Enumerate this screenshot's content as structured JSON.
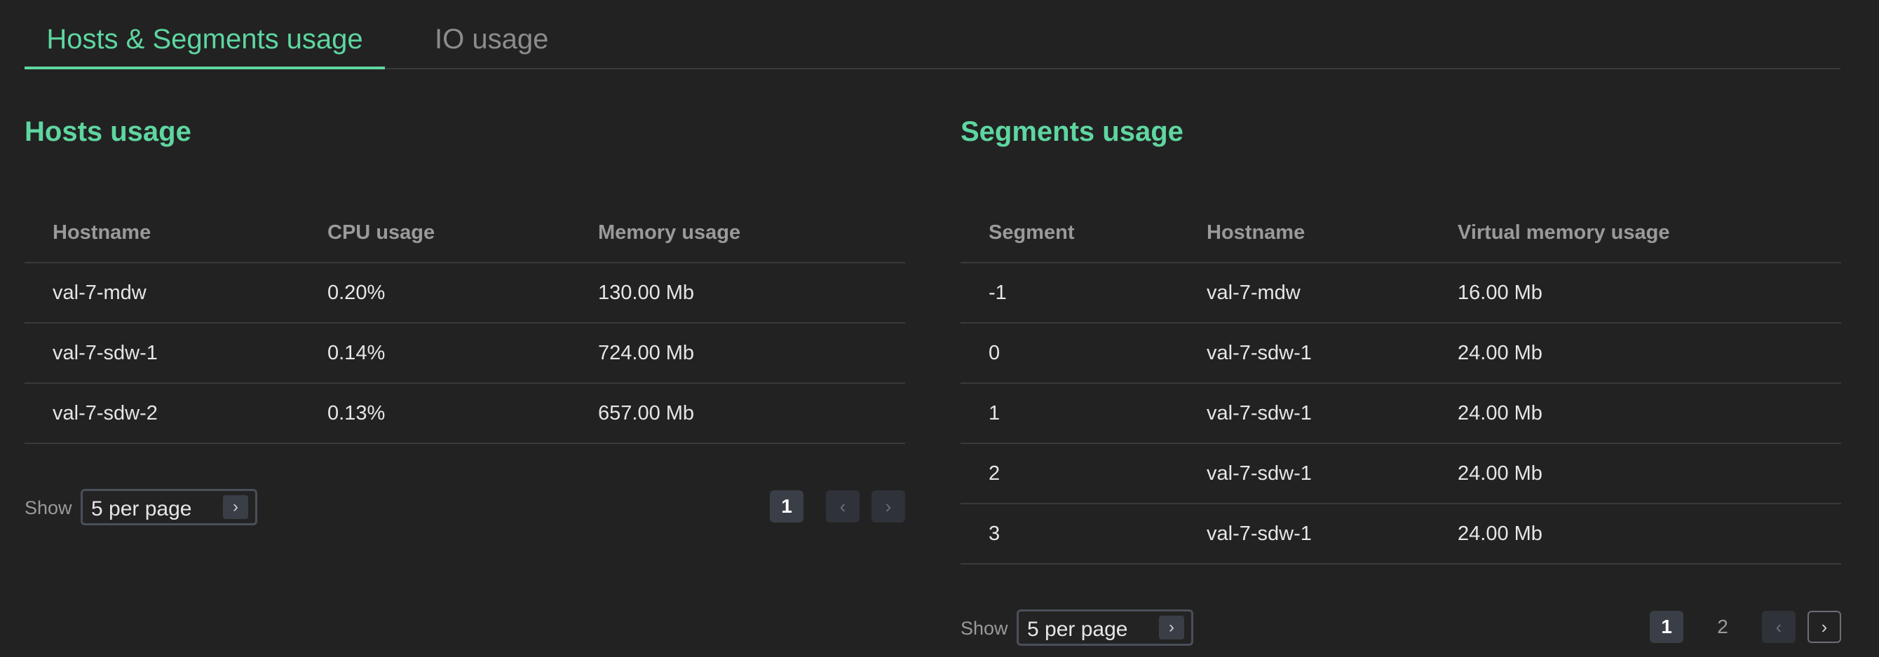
{
  "tabs": {
    "active_label": "Hosts & Segments usage",
    "inactive_label": "IO usage"
  },
  "hosts": {
    "title": "Hosts usage",
    "columns": [
      "Hostname",
      "CPU usage",
      "Memory usage"
    ],
    "rows": [
      [
        "val-7-mdw",
        "0.20%",
        "130.00 Mb"
      ],
      [
        "val-7-sdw-1",
        "0.14%",
        "724.00 Mb"
      ],
      [
        "val-7-sdw-2",
        "0.13%",
        "657.00 Mb"
      ]
    ],
    "pager": {
      "show_label": "Show",
      "per_page": "5 per page",
      "pages": [
        "1"
      ],
      "current_page": "1"
    }
  },
  "segments": {
    "title": "Segments usage",
    "columns": [
      "Segment",
      "Hostname",
      "Virtual memory usage"
    ],
    "rows": [
      [
        "-1",
        "val-7-mdw",
        "16.00 Mb"
      ],
      [
        "0",
        "val-7-sdw-1",
        "24.00 Mb"
      ],
      [
        "1",
        "val-7-sdw-1",
        "24.00 Mb"
      ],
      [
        "2",
        "val-7-sdw-1",
        "24.00 Mb"
      ],
      [
        "3",
        "val-7-sdw-1",
        "24.00 Mb"
      ]
    ],
    "pager": {
      "show_label": "Show",
      "per_page": "5 per page",
      "pages": [
        "1",
        "2"
      ],
      "current_page": "1"
    }
  },
  "icons": {
    "chevron_right": "›",
    "chevron_left": "‹"
  },
  "colors": {
    "accent": "#5ed6a0",
    "background": "#222222",
    "muted_text": "#9a9a9a"
  }
}
